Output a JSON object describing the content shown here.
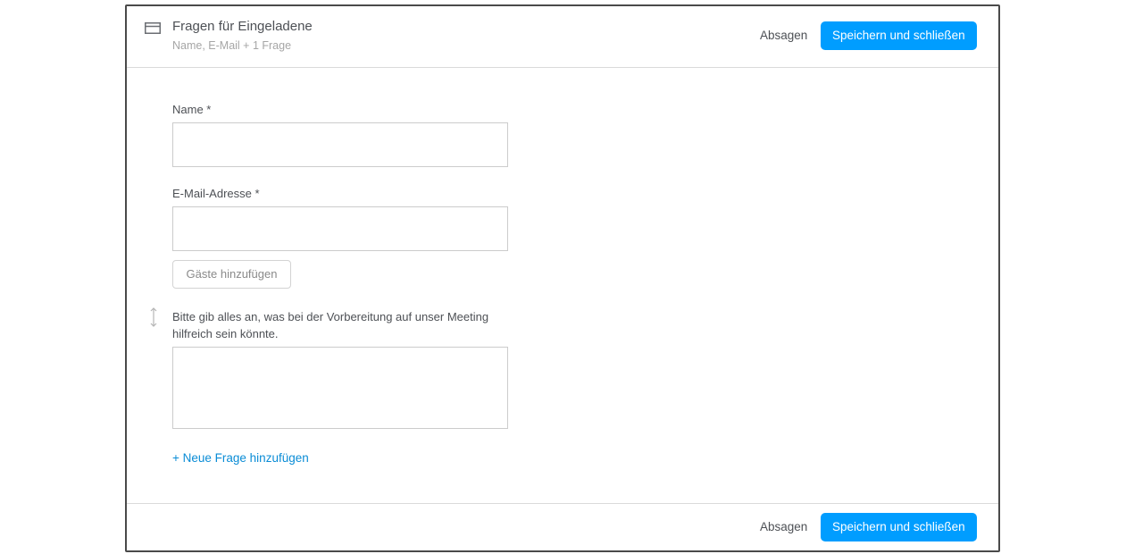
{
  "header": {
    "title": "Fragen für Eingeladene",
    "subtitle": "Name, E-Mail + 1 Frage",
    "cancel_label": "Absagen",
    "save_label": "Speichern und schließen"
  },
  "form": {
    "name_label": "Name *",
    "name_value": "",
    "email_label": "E-Mail-Adresse *",
    "email_value": "",
    "add_guests_label": "Gäste hinzufügen",
    "question_label": "Bitte gib alles an, was bei der Vorbereitung auf unser Meeting hilfreich sein könnte.",
    "question_value": "",
    "add_question_label": "+ Neue Frage hinzufügen"
  },
  "footer": {
    "cancel_label": "Absagen",
    "save_label": "Speichern und schließen"
  },
  "colors": {
    "primary": "#009dff",
    "link": "#0a8cd6",
    "text": "#4d5055",
    "muted": "#a6a6a6",
    "border": "#cccccc"
  },
  "icons": {
    "header": "card-icon",
    "handle": "drag-handle-icon"
  }
}
